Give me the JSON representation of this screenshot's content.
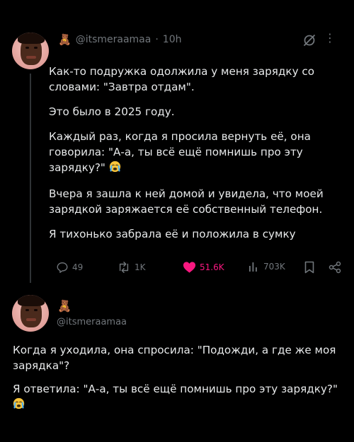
{
  "post1": {
    "author_emoji": "🧸",
    "handle": "@itsmeraamaa",
    "separator": "·",
    "time": "10h",
    "paragraphs": [
      "Как-то подружка одолжила у меня зарядку со словами: \"Завтра отдам\".",
      "Это было в 2025 году.",
      "Каждый раз, когда я просила вернуть её, она говорила: \"А-а, ты всё ещё помнишь про эту зарядку?\"",
      "Вчера я зашла к ней домой и увидела, что моей зарядкой заряжается её собственный телефон.",
      "Я тихонько забрала её и положила в сумку"
    ],
    "actions": {
      "replies": "49",
      "reposts": "1K",
      "likes": "51.6K",
      "views": "703K"
    }
  },
  "post2": {
    "author_emoji": "🧸",
    "handle": "@itsmeraamaa",
    "paragraphs": [
      "Когда я уходила, она спросила: \"Подожди, а где же моя зарядка\"?",
      "Я ответила: \"А-а, ты всё ещё помнишь про эту зарядку?\""
    ]
  },
  "colors": {
    "background": "#000000",
    "text": "#e7e9ea",
    "muted": "#71767b",
    "like": "#f91880"
  },
  "icons": [
    "reply-icon",
    "repost-icon",
    "heart-icon",
    "views-icon",
    "bookmark-icon",
    "share-icon",
    "grok-icon",
    "more-icon",
    "crying-emoji"
  ]
}
